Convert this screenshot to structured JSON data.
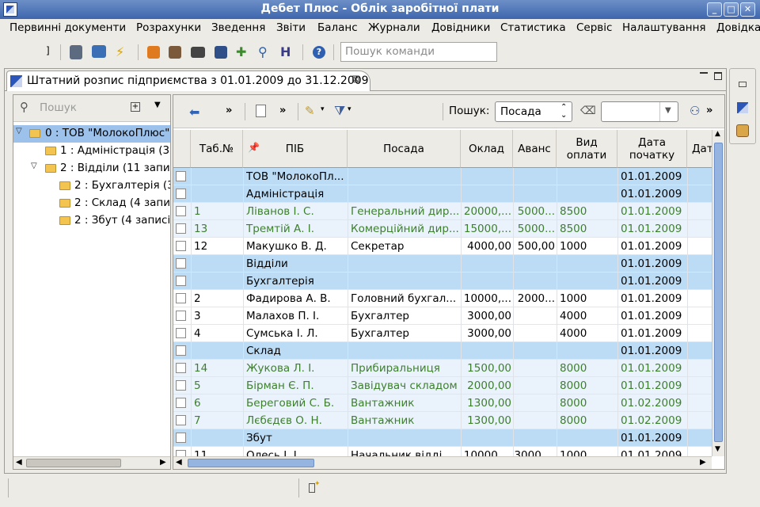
{
  "window": {
    "title": "Дебет Плюс - Облік заробітної плати"
  },
  "menu": [
    "Первинні документи",
    "Розрахунки",
    "Зведення",
    "Звіти",
    "Баланс",
    "Журнали",
    "Довідники",
    "Статистика",
    "Сервіс",
    "Налаштування",
    "Довідка"
  ],
  "command_search": {
    "placeholder": "Пошук команди"
  },
  "tab": {
    "title": "Штатний розпис підприємства з 01.01.2009 до 31.12.2009"
  },
  "tree_search": {
    "placeholder": "Пошук"
  },
  "tree": [
    {
      "label": "0 : ТОВ \"МолокоПлюс\"",
      "level": 0,
      "expanded": true,
      "selected": true
    },
    {
      "label": "1 : Адміністрація (3",
      "level": 1,
      "expanded": false
    },
    {
      "label": "2 : Відділи (11 запис",
      "level": 1,
      "expanded": true
    },
    {
      "label": "2 : Бухгалтерія (3",
      "level": 2,
      "expanded": false
    },
    {
      "label": "2 : Склад (4 запис",
      "level": 2,
      "expanded": false
    },
    {
      "label": "2 : Збут (4 записі",
      "level": 2,
      "expanded": false
    }
  ],
  "grid_toolbar": {
    "search_label": "Пошук:",
    "search_field": "Посада",
    "search_value": ""
  },
  "columns": [
    "Таб.№",
    "ПІБ",
    "Посада",
    "Оклад",
    "Аванс",
    "Вид оплати",
    "Дата початку",
    "Дата зак"
  ],
  "rows": [
    {
      "type": "group",
      "tab": "",
      "name": "ТОВ \"МолокоПл...",
      "pos": "",
      "salary": "",
      "advance": "",
      "paytype": "",
      "start": "01.01.2009"
    },
    {
      "type": "group",
      "tab": "",
      "name": "Адміністрація",
      "pos": "",
      "salary": "",
      "advance": "",
      "paytype": "",
      "start": "01.01.2009"
    },
    {
      "type": "green",
      "tab": "1",
      "name": "Ліванов І. С.",
      "pos": "Генеральний дир...",
      "salary": "20000,...",
      "advance": "5000...",
      "paytype": "8500",
      "start": "01.01.2009"
    },
    {
      "type": "green",
      "tab": "13",
      "name": "Тремтій А. І.",
      "pos": "Комерційний дир...",
      "salary": "15000,...",
      "advance": "5000...",
      "paytype": "8500",
      "start": "01.01.2009"
    },
    {
      "type": "plain",
      "tab": "12",
      "name": "Макушко В. Д.",
      "pos": "Секретар",
      "salary": "4000,00",
      "advance": "500,00",
      "paytype": "1000",
      "start": "01.01.2009"
    },
    {
      "type": "group",
      "tab": "",
      "name": "Відділи",
      "pos": "",
      "salary": "",
      "advance": "",
      "paytype": "",
      "start": "01.01.2009"
    },
    {
      "type": "group",
      "tab": "",
      "name": "Бухгалтерія",
      "pos": "",
      "salary": "",
      "advance": "",
      "paytype": "",
      "start": "01.01.2009"
    },
    {
      "type": "plain",
      "tab": "2",
      "name": "Фадирова А. В.",
      "pos": "Головний бухгал...",
      "salary": "10000,...",
      "advance": "2000...",
      "paytype": "1000",
      "start": "01.01.2009"
    },
    {
      "type": "plain",
      "tab": "3",
      "name": "Малахов П. І.",
      "pos": "Бухгалтер",
      "salary": "3000,00",
      "advance": "",
      "paytype": "4000",
      "start": "01.01.2009"
    },
    {
      "type": "plain",
      "tab": "4",
      "name": "Сумська І. Л.",
      "pos": "Бухгалтер",
      "salary": "3000,00",
      "advance": "",
      "paytype": "4000",
      "start": "01.01.2009"
    },
    {
      "type": "group",
      "tab": "",
      "name": "Склад",
      "pos": "",
      "salary": "",
      "advance": "",
      "paytype": "",
      "start": "01.01.2009"
    },
    {
      "type": "green",
      "tab": "14",
      "name": "Жукова Л. І.",
      "pos": "Прибиральниця",
      "salary": "1500,00",
      "advance": "",
      "paytype": "8000",
      "start": "01.01.2009"
    },
    {
      "type": "green",
      "tab": "5",
      "name": "Бірман Є. П.",
      "pos": "Завідувач складом",
      "salary": "2000,00",
      "advance": "",
      "paytype": "8000",
      "start": "01.01.2009"
    },
    {
      "type": "green",
      "tab": "6",
      "name": "Береговий С. Б.",
      "pos": "Вантажник",
      "salary": "1300,00",
      "advance": "",
      "paytype": "8000",
      "start": "01.02.2009"
    },
    {
      "type": "green",
      "tab": "7",
      "name": "Лєбєдєв О. Н.",
      "pos": "Вантажник",
      "salary": "1300,00",
      "advance": "",
      "paytype": "8000",
      "start": "01.02.2009"
    },
    {
      "type": "group",
      "tab": "",
      "name": "Збут",
      "pos": "",
      "salary": "",
      "advance": "",
      "paytype": "",
      "start": "01.01.2009"
    },
    {
      "type": "plain",
      "tab": "11",
      "name": "Олесь І. І.",
      "pos": "Начальник відді...",
      "salary": "10000,...",
      "advance": "3000,...",
      "paytype": "1000",
      "start": "01.01.2009"
    }
  ],
  "colors": {
    "group_row": "#bcdcf5",
    "alt_row": "#eaf3fc",
    "green_text": "#3e7f2e",
    "title_bar": "#4a70b3"
  }
}
